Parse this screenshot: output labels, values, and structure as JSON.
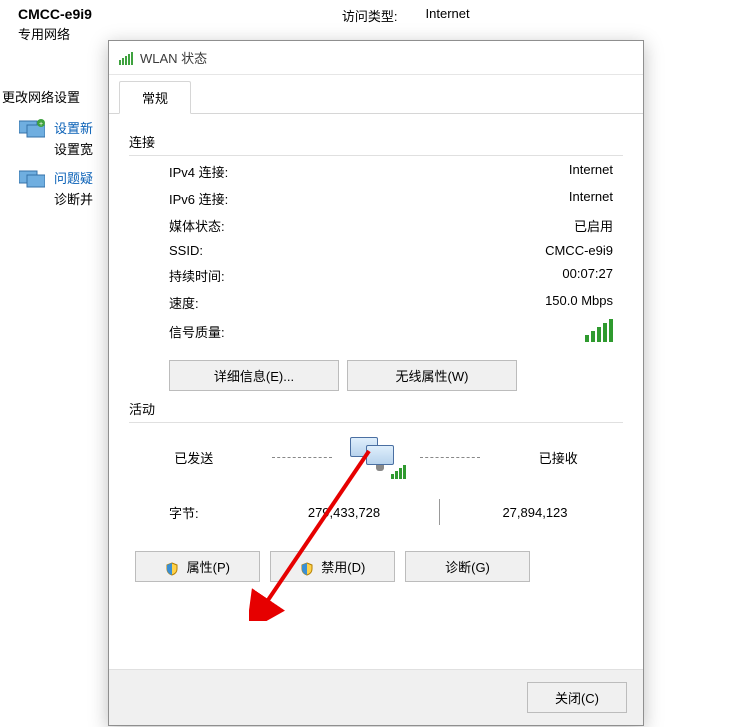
{
  "background": {
    "network_name": "CMCC-e9i9",
    "network_sub": "专用网络",
    "access_label": "访问类型:",
    "access_value": "Internet",
    "change_settings": "更改网络设置",
    "item1_link": "设置新",
    "item1_desc": "设置宽",
    "item2_link": "问题疑",
    "item2_desc": "诊断并"
  },
  "dialog": {
    "title": "WLAN 状态",
    "tab": "常规",
    "group_connection": "连接",
    "ipv4_label": "IPv4 连接:",
    "ipv4_value": "Internet",
    "ipv6_label": "IPv6 连接:",
    "ipv6_value": "Internet",
    "media_label": "媒体状态:",
    "media_value": "已启用",
    "ssid_label": "SSID:",
    "ssid_value": "CMCC-e9i9",
    "duration_label": "持续时间:",
    "duration_value": "00:07:27",
    "speed_label": "速度:",
    "speed_value": "150.0 Mbps",
    "signal_label": "信号质量:",
    "btn_details": "详细信息(E)...",
    "btn_wireless": "无线属性(W)",
    "group_activity": "活动",
    "sent_label": "已发送",
    "recv_label": "已接收",
    "bytes_label": "字节:",
    "bytes_sent": "279,433,728",
    "bytes_recv": "27,894,123",
    "btn_properties": "属性(P)",
    "btn_disable": "禁用(D)",
    "btn_diagnose": "诊断(G)",
    "btn_close": "关闭(C)"
  }
}
